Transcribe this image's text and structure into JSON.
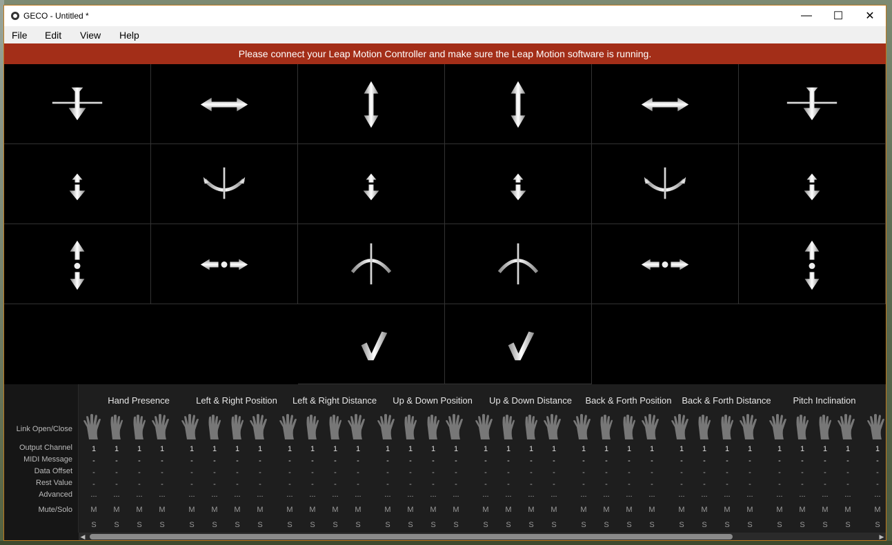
{
  "window": {
    "title": "GECO - Untitled *"
  },
  "menu": [
    "File",
    "Edit",
    "View",
    "Help"
  ],
  "banner": {
    "text": "Please connect your Leap Motion Controller and make sure the Leap Motion software is running.",
    "color": "#a32e18"
  },
  "gestures": [
    [
      "plane-icon",
      "horizontal-arrow-icon",
      "vertical-arrow-icon",
      "vertical-arrow-icon",
      "horizontal-arrow-icon",
      "plane-icon"
    ],
    [
      "small-vertical-arrow-icon",
      "roll-arc-icon",
      "small-vertical-arrow-icon",
      "small-vertical-arrow-icon",
      "roll-arc-icon",
      "small-vertical-arrow-icon"
    ],
    [
      "vertical-distance-icon",
      "horizontal-distance-icon",
      "pitch-arc-icon",
      "pitch-arc-icon",
      "horizontal-distance-icon",
      "vertical-distance-icon"
    ],
    [
      "",
      "",
      "checkmark-icon",
      "checkmark-icon",
      "",
      ""
    ]
  ],
  "params": {
    "row_labels": {
      "link": "Link Open/Close",
      "channel": "Output Channel",
      "midi": "MIDI Message",
      "offset": "Data Offset",
      "rest": "Rest Value",
      "advanced": "Advanced",
      "mute_solo": "Mute/Solo"
    },
    "columns": [
      {
        "title": "Hand Presence"
      },
      {
        "title": "Left & Right Position"
      },
      {
        "title": "Left & Right Distance"
      },
      {
        "title": "Up & Down Position"
      },
      {
        "title": "Up & Down Distance"
      },
      {
        "title": "Back & Forth Position"
      },
      {
        "title": "Back & Forth Distance"
      },
      {
        "title": "Pitch Inclination"
      }
    ],
    "cell_values": {
      "channel": "1",
      "midi": "-",
      "offset": "-",
      "rest": "-",
      "advanced": "...",
      "mute": "M",
      "solo": "S"
    }
  }
}
